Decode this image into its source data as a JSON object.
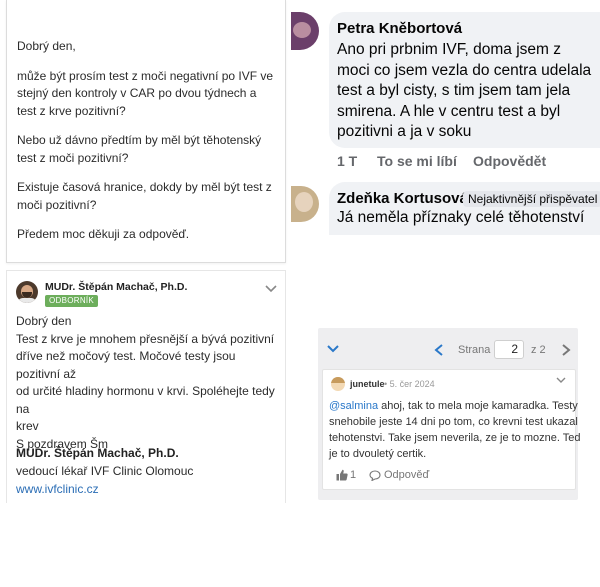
{
  "question": {
    "paragraphs": [
      "Dobrý den,",
      "může být prosím test z moči negativní po IVF ve stejný den kontroly v CAR po dvou týdnech a test z krve pozitivní?",
      "Nebo už dávno předtím by měl být těhotenský test z moči pozitivní?",
      "Existuje časová hranice, dokdy by měl být test z moči pozitivní?",
      "Předem moc děkuji za odpověď."
    ]
  },
  "answer": {
    "author": "MUDr. Štěpán Machač, Ph.D.",
    "badge": "ODBORNÍK",
    "lines": [
      "Dobrý den",
      "Test z krve je mnohem přesnější a bývá pozitivní",
      "dříve než močový test. Močové testy jsou pozitivní až",
      "od určité hladiny hormonu v krvi. Spoléhejte tedy na",
      "krev",
      "S pozdravem Šm"
    ],
    "signature_name": "MUDr. Štěpán Machač, Ph.D.",
    "signature_role": "vedoucí lékař IVF Clinic Olomouc",
    "signature_link": "www.ivfclinic.cz"
  },
  "facebook": {
    "comment1": {
      "author": "Petra Kněbortová",
      "lines": [
        "Ano pri prbnim IVF, doma jsem z",
        "moci co jsem vezla do centra udelala",
        "test a byl cisty, s tim jsem tam jela",
        "smirena. A hle v centru test a byl",
        "pozitivni a ja v soku"
      ],
      "reactions": "1 T",
      "like_label": "To se mi líbí",
      "reply_label": "Odpovědět"
    },
    "comment2": {
      "author": "Zdeňka Kortusová",
      "badge": "Nejaktivnější přispěvatel",
      "text": "Já neměla příznaky celé těhotenství"
    }
  },
  "forum": {
    "page_label": "Strana",
    "current_page": "2",
    "of_label": "z 2",
    "post": {
      "username": "junetule",
      "date": "• 5. čer 2024",
      "mention": "@salmina",
      "first_line_rest": " ahoj, tak to mela moje kamaradka. Testy",
      "lines": [
        "snehobile jeste 14 dni po tom, co krevni test ukazal",
        "tehotenstvi. Take jsem neverila, ze je to mozne. Ted",
        "je to dvouletý certik."
      ],
      "likes": "1",
      "reply_label": "Odpověď"
    }
  }
}
